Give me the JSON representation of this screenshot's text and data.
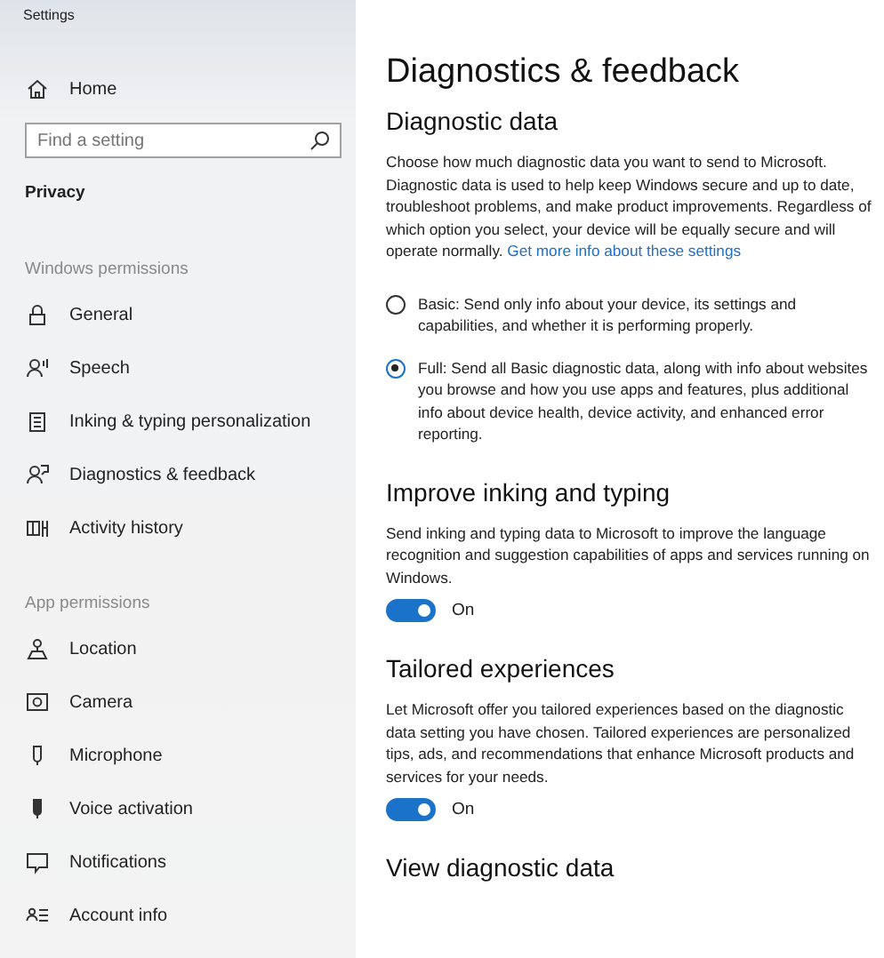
{
  "window": {
    "title": "Settings"
  },
  "sidebar": {
    "home": "Home",
    "search": {
      "placeholder": "Find a setting"
    },
    "section": "Privacy",
    "groups": [
      {
        "heading": "Windows permissions",
        "items": [
          {
            "label": "General"
          },
          {
            "label": "Speech"
          },
          {
            "label": "Inking & typing personalization"
          },
          {
            "label": "Diagnostics & feedback"
          },
          {
            "label": "Activity history"
          }
        ]
      },
      {
        "heading": "App permissions",
        "items": [
          {
            "label": "Location"
          },
          {
            "label": "Camera"
          },
          {
            "label": "Microphone"
          },
          {
            "label": "Voice activation"
          },
          {
            "label": "Notifications"
          },
          {
            "label": "Account info"
          }
        ]
      }
    ]
  },
  "page": {
    "title": "Diagnostics & feedback",
    "sections": [
      {
        "kind": "radio",
        "heading": "Diagnostic data",
        "description": "Choose how much diagnostic data you want to send to Microsoft. Diagnostic data is used to help keep Windows secure and up to date, troubleshoot problems, and make product improvements. Regardless of which option you select, your device will be equally secure and will operate normally.",
        "link": "Get more info about these settings",
        "options": [
          {
            "label": "Basic: Send only info about your device, its settings and capabilities, and whether it is performing properly.",
            "selected": false
          },
          {
            "label": "Full: Send all Basic diagnostic data, along with info about websites you browse and how you use apps and features, plus additional info about device health, device activity, and enhanced error reporting.",
            "selected": true
          }
        ]
      },
      {
        "kind": "toggle",
        "heading": "Improve inking and typing",
        "description": "Send inking and typing data to Microsoft to improve the language recognition and suggestion capabilities of apps and services running on Windows.",
        "toggle": {
          "on": true,
          "label": "On"
        }
      },
      {
        "kind": "toggle",
        "heading": "Tailored experiences",
        "description": "Let Microsoft offer you tailored experiences based on the diagnostic data setting you have chosen. Tailored experiences are personalized tips, ads, and recommendations that enhance Microsoft products and services for your needs.",
        "toggle": {
          "on": true,
          "label": "On"
        }
      },
      {
        "kind": "heading",
        "heading": "View diagnostic data"
      }
    ]
  }
}
